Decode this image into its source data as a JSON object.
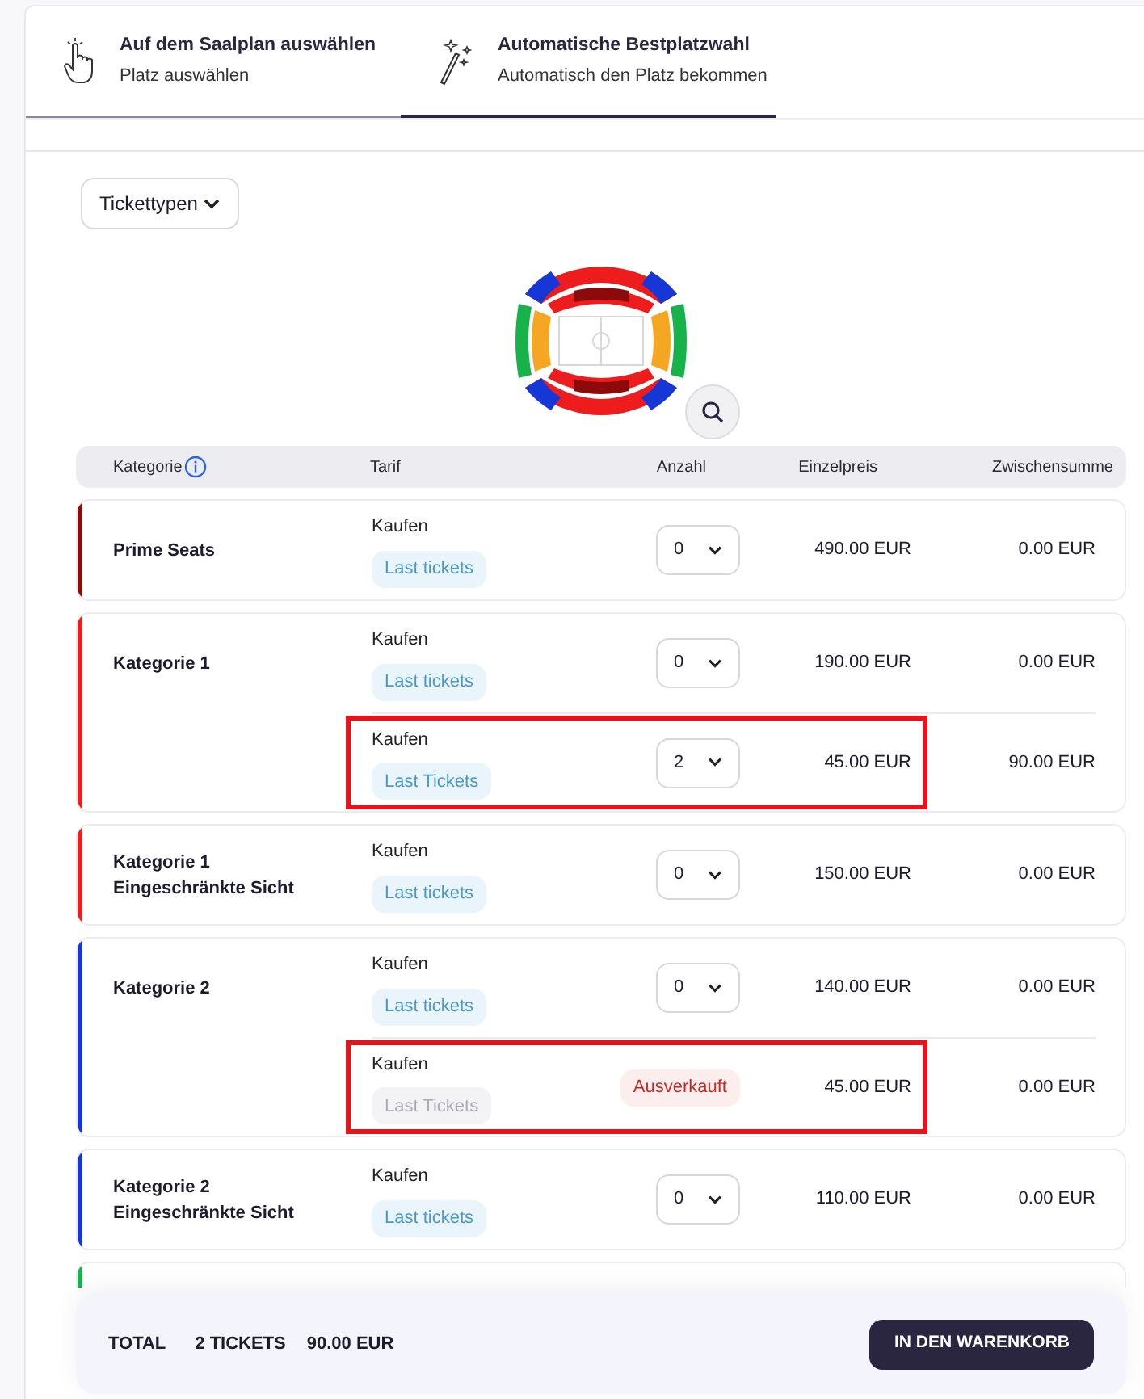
{
  "tabs": [
    {
      "kind": "hand",
      "title": "Auf dem Saalplan auswählen",
      "subtitle": "Platz auswählen",
      "selected": false
    },
    {
      "kind": "wand",
      "title": "Automatische Bestplatzwahl",
      "subtitle": "Automatisch den Platz bekommen",
      "selected": true
    }
  ],
  "ticket_type_button": "Tickettypen",
  "table": {
    "columns": [
      "Kategorie",
      "Tarif",
      "Anzahl",
      "Einzelpreis",
      "Zwischensumme"
    ],
    "categories": [
      {
        "name": "Prime Seats",
        "color": "#8b0a0a",
        "rates": [
          {
            "label": "Kaufen",
            "badge": "Last tickets",
            "badge_disabled": false,
            "kind": "select",
            "quantity": "0",
            "unit_price": "490.00 EUR",
            "subtotal": "0.00 EUR",
            "highlighted": false
          }
        ]
      },
      {
        "name": "Kategorie 1",
        "color": "#ee1c1c",
        "rates": [
          {
            "label": "Kaufen",
            "badge": "Last tickets",
            "badge_disabled": false,
            "kind": "select",
            "quantity": "0",
            "unit_price": "190.00 EUR",
            "subtotal": "0.00 EUR",
            "highlighted": false
          },
          {
            "label": "Kaufen",
            "badge": "Last Tickets",
            "badge_disabled": false,
            "kind": "select",
            "quantity": "2",
            "unit_price": "45.00 EUR",
            "subtotal": "90.00 EUR",
            "highlighted": true
          }
        ]
      },
      {
        "name": "Kategorie 1 Eingeschränkte Sicht",
        "color": "#ee1c1c",
        "rates": [
          {
            "label": "Kaufen",
            "badge": "Last tickets",
            "badge_disabled": false,
            "kind": "select",
            "quantity": "0",
            "unit_price": "150.00 EUR",
            "subtotal": "0.00 EUR",
            "highlighted": false
          }
        ]
      },
      {
        "name": "Kategorie 2",
        "color": "#1636d6",
        "rates": [
          {
            "label": "Kaufen",
            "badge": "Last tickets",
            "badge_disabled": false,
            "kind": "select",
            "quantity": "0",
            "unit_price": "140.00 EUR",
            "subtotal": "0.00 EUR",
            "highlighted": false
          },
          {
            "label": "Kaufen",
            "badge": "Last Tickets",
            "badge_disabled": true,
            "kind": "sold_out",
            "status": "Ausverkauft",
            "unit_price": "45.00 EUR",
            "subtotal": "0.00 EUR",
            "highlighted": true
          }
        ]
      },
      {
        "name": "Kategorie 2 Eingeschränkte Sicht",
        "color": "#1636d6",
        "rates": [
          {
            "label": "Kaufen",
            "badge": "Last tickets",
            "badge_disabled": false,
            "kind": "select",
            "quantity": "0",
            "unit_price": "110.00 EUR",
            "subtotal": "0.00 EUR",
            "highlighted": false
          }
        ]
      }
    ],
    "partial_category": {
      "color": "#17b34a"
    }
  },
  "footer": {
    "total_label": "TOTAL",
    "tickets": "2 TICKETS",
    "amount": "90.00 EUR",
    "button": "IN DEN WARENKORB"
  }
}
